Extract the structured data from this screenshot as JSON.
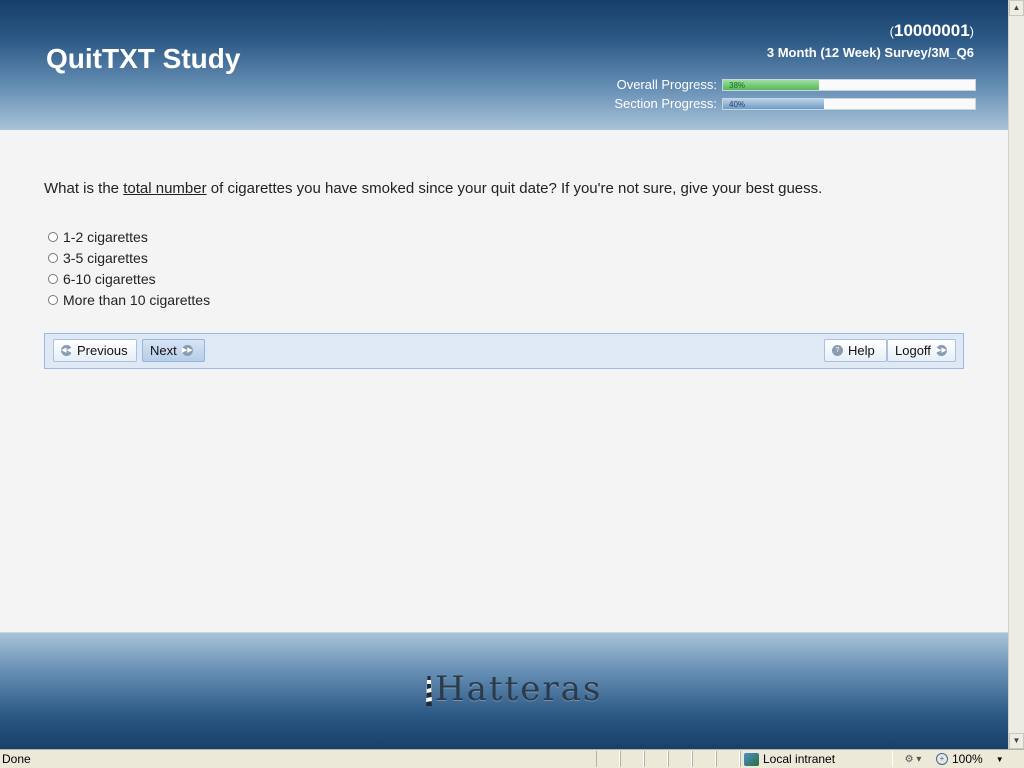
{
  "header": {
    "app_title": "QuitTXT Study",
    "participant_open": "(",
    "participant_id": "10000001",
    "participant_close": ")",
    "survey_title": "3 Month (12 Week) Survey/3M_Q6",
    "progress": {
      "overall_label": "Overall Progress:",
      "overall_pct_text": "38%",
      "overall_fraction": 0.38,
      "section_label": "Section Progress:",
      "section_pct_text": "40%",
      "section_fraction": 0.4,
      "overall_color": "#55b85a",
      "section_color": "#6f9cc4"
    }
  },
  "question": {
    "before": "What is the ",
    "emphasis": "total number",
    "after": " of cigarettes you have smoked since your quit date? If you're not sure, give your best guess."
  },
  "options": [
    "1-2 cigarettes",
    "3-5 cigarettes",
    "6-10 cigarettes",
    "More than 10 cigarettes"
  ],
  "nav": {
    "previous_label": "Previous",
    "next_label": "Next",
    "help_label": "Help",
    "logoff_label": "Logoff"
  },
  "footer": {
    "logo_text": "Hatteras"
  },
  "statusbar": {
    "status": "Done",
    "zone": "Local intranet",
    "zoom": "100%"
  },
  "icons": {
    "previous": "rewind-circle-icon",
    "next": "forward-circle-icon",
    "help": "help-circle-icon",
    "logoff": "forward-circle-icon",
    "zone": "intranet-globe-icon",
    "zoom": "magnifier-icon"
  },
  "colors": {
    "header_dark": "#173f69",
    "header_light": "#a9c3d8",
    "nav_bar": "#dfe8f5",
    "page_bg": "#f4f4f4"
  }
}
